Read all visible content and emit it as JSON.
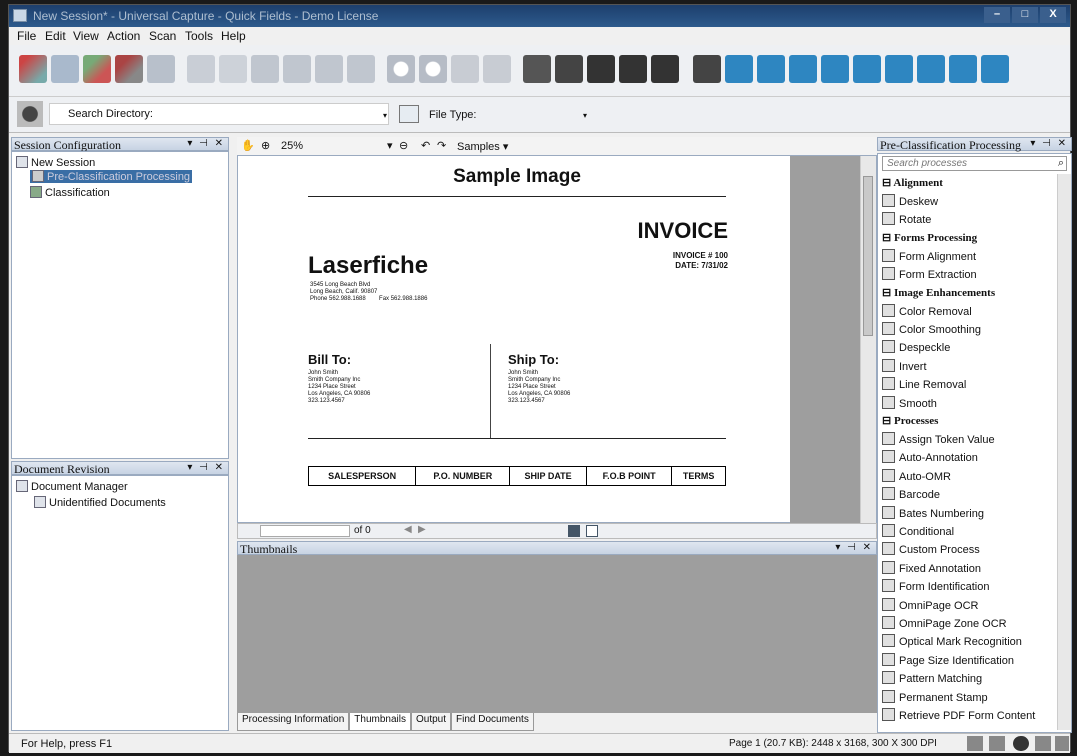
{
  "window": {
    "title": "New Session* - Universal Capture - Quick Fields - Demo License",
    "controls": [
      "–",
      "□",
      "X"
    ]
  },
  "menu": [
    "File",
    "Edit",
    "View",
    "Action",
    "Scan",
    "Tools",
    "Help"
  ],
  "search_bar": {
    "directory_label": "Search Directory:",
    "file_type_label": "File Type:"
  },
  "session_configuration": {
    "title": "Session Configuration",
    "controls": "▾ ⊣ ✕",
    "items": [
      "New Session",
      "Pre-Classification Processing",
      "Classification"
    ]
  },
  "document_revision": {
    "title": "Document Revision",
    "controls": "▾ ⊣ ✕",
    "items": [
      "Document Manager",
      "Unidentified Documents"
    ]
  },
  "viewer": {
    "zoom": "25%",
    "samples_label": "Samples ▾",
    "page_of": "of 0",
    "document": {
      "heading": "Sample Image",
      "invoice_title": "INVOICE",
      "invoice_number": "INVOICE # 100",
      "invoice_date": "DATE: 7/31/02",
      "company": "Laserfiche",
      "address1": "3545 Long Beach Blvd",
      "address2": "Long Beach, Calif. 90807",
      "phone": "Phone 562.988.1688        Fax 562.988.1886",
      "bill_to_label": "Bill To:",
      "ship_to_label": "Ship To:",
      "bill_to_lines": [
        "John Smith",
        "Smith Company Inc",
        "1234 Place Street",
        "Los Angeles, CA 90806",
        "323.123.4567"
      ],
      "ship_to_lines": [
        "John Smith",
        "Smith Company Inc",
        "1234 Place Street",
        "Los Angeles, CA 90806",
        "323.123.4567"
      ],
      "table_headers": [
        "SALESPERSON",
        "P.O. NUMBER",
        "SHIP DATE",
        "F.O.B POINT",
        "TERMS"
      ]
    }
  },
  "thumbnails": {
    "title": "Thumbnails",
    "controls": "▾ ⊣ ✕"
  },
  "bottom_tabs": [
    "Processing Information",
    "Thumbnails",
    "Output",
    "Find Documents"
  ],
  "pre_classification": {
    "title": "Pre-Classification Processing",
    "controls": "▾ ⊣ ✕",
    "search_placeholder": "Search processes",
    "groups": [
      {
        "name": "Alignment",
        "items": [
          "Deskew",
          "Rotate"
        ]
      },
      {
        "name": "Forms Processing",
        "items": [
          "Form Alignment",
          "Form Extraction"
        ]
      },
      {
        "name": "Image Enhancements",
        "items": [
          "Color Removal",
          "Color Smoothing",
          "Despeckle",
          "Invert",
          "Line Removal",
          "Smooth"
        ]
      },
      {
        "name": "Processes",
        "items": [
          "Assign Token Value",
          "Auto-Annotation",
          "Auto-OMR",
          "Barcode",
          "Bates Numbering",
          "Conditional",
          "Custom Process",
          "Fixed Annotation",
          "Form Identification",
          "OmniPage OCR",
          "OmniPage Zone OCR",
          "Optical Mark Recognition",
          "Page Size Identification",
          "Pattern Matching",
          "Permanent Stamp",
          "Retrieve PDF Form Content"
        ]
      }
    ]
  },
  "status": {
    "help": "For Help, press F1",
    "page_info": "Page 1 (20.7 KB): 2448 x 3168, 300 X 300 DPI"
  },
  "colors": {
    "titlebar": "#1d3f6d",
    "panel_header": "#c7d3e3",
    "selection": "#3a6ea5",
    "thumb_area": "#9e9e9e"
  }
}
